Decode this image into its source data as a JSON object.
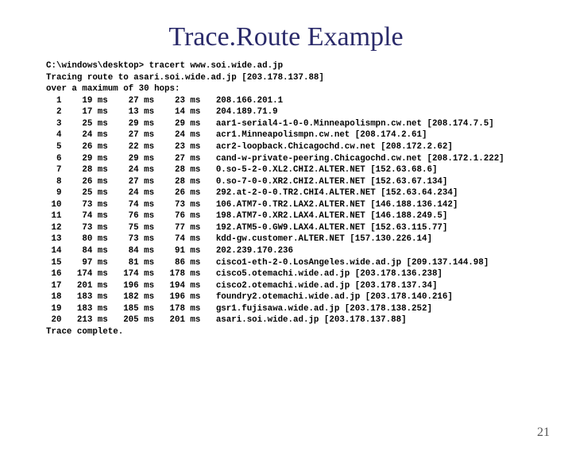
{
  "title": "Trace.Route Example",
  "pagenum": "21",
  "cmd_prompt": "C:\\windows\\desktop> tracert www.soi.wide.ad.jp",
  "resolve_line": "Tracing route to asari.soi.wide.ad.jp [203.178.137.88]",
  "over_line": "over a maximum of 30 hops:",
  "complete_line": "Trace complete.",
  "hops": [
    {
      "n": "1",
      "a": "19",
      "b": "27",
      "c": "23",
      "host": "208.166.201.1"
    },
    {
      "n": "2",
      "a": "17",
      "b": "13",
      "c": "14",
      "host": "204.189.71.9"
    },
    {
      "n": "3",
      "a": "25",
      "b": "29",
      "c": "29",
      "host": "aar1-serial4-1-0-0.Minneapolismpn.cw.net [208.174.7.5]"
    },
    {
      "n": "4",
      "a": "24",
      "b": "27",
      "c": "24",
      "host": "acr1.Minneapolismpn.cw.net [208.174.2.61]"
    },
    {
      "n": "5",
      "a": "26",
      "b": "22",
      "c": "23",
      "host": "acr2-loopback.Chicagochd.cw.net [208.172.2.62]"
    },
    {
      "n": "6",
      "a": "29",
      "b": "29",
      "c": "27",
      "host": "cand-w-private-peering.Chicagochd.cw.net [208.172.1.222]"
    },
    {
      "n": "7",
      "a": "28",
      "b": "24",
      "c": "28",
      "host": "0.so-5-2-0.XL2.CHI2.ALTER.NET [152.63.68.6]"
    },
    {
      "n": "8",
      "a": "26",
      "b": "27",
      "c": "28",
      "host": "0.so-7-0-0.XR2.CHI2.ALTER.NET [152.63.67.134]"
    },
    {
      "n": "9",
      "a": "25",
      "b": "24",
      "c": "26",
      "host": "292.at-2-0-0.TR2.CHI4.ALTER.NET [152.63.64.234]"
    },
    {
      "n": "10",
      "a": "73",
      "b": "74",
      "c": "73",
      "host": "106.ATM7-0.TR2.LAX2.ALTER.NET [146.188.136.142]"
    },
    {
      "n": "11",
      "a": "74",
      "b": "76",
      "c": "76",
      "host": "198.ATM7-0.XR2.LAX4.ALTER.NET [146.188.249.5]"
    },
    {
      "n": "12",
      "a": "73",
      "b": "75",
      "c": "77",
      "host": "192.ATM5-0.GW9.LAX4.ALTER.NET [152.63.115.77]"
    },
    {
      "n": "13",
      "a": "80",
      "b": "73",
      "c": "74",
      "host": "kdd-gw.customer.ALTER.NET [157.130.226.14]"
    },
    {
      "n": "14",
      "a": "84",
      "b": "84",
      "c": "91",
      "host": "202.239.170.236"
    },
    {
      "n": "15",
      "a": "97",
      "b": "81",
      "c": "86",
      "host": "cisco1-eth-2-0.LosAngeles.wide.ad.jp [209.137.144.98]"
    },
    {
      "n": "16",
      "a": "174",
      "b": "174",
      "c": "178",
      "host": "cisco5.otemachi.wide.ad.jp [203.178.136.238]"
    },
    {
      "n": "17",
      "a": "201",
      "b": "196",
      "c": "194",
      "host": "cisco2.otemachi.wide.ad.jp [203.178.137.34]"
    },
    {
      "n": "18",
      "a": "183",
      "b": "182",
      "c": "196",
      "host": "foundry2.otemachi.wide.ad.jp [203.178.140.216]"
    },
    {
      "n": "19",
      "a": "183",
      "b": "185",
      "c": "178",
      "host": "gsr1.fujisawa.wide.ad.jp [203.178.138.252]"
    },
    {
      "n": "20",
      "a": "213",
      "b": "205",
      "c": "201",
      "host": "asari.soi.wide.ad.jp [203.178.137.88]"
    }
  ]
}
